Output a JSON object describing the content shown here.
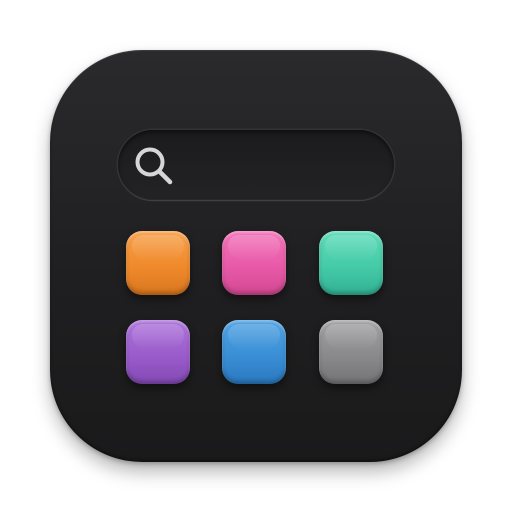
{
  "app_icon": {
    "search_bar": {
      "icon": "search-icon"
    },
    "tiles": [
      {
        "color": "#F08A2C",
        "color_light": "#F7A04A",
        "color_dark": "#D9761E"
      },
      {
        "color": "#E85AA8",
        "color_light": "#F274B9",
        "color_dark": "#D34892"
      },
      {
        "color": "#45CBA8",
        "color_light": "#5EDBB9",
        "color_dark": "#32B293"
      },
      {
        "color": "#9A5CCB",
        "color_light": "#AD74DA",
        "color_dark": "#844AB5"
      },
      {
        "color": "#3A8FD6",
        "color_light": "#52A2E2",
        "color_dark": "#2A79BF"
      },
      {
        "color": "#8A8A8C",
        "color_light": "#A2A2A4",
        "color_dark": "#747476"
      }
    ]
  }
}
